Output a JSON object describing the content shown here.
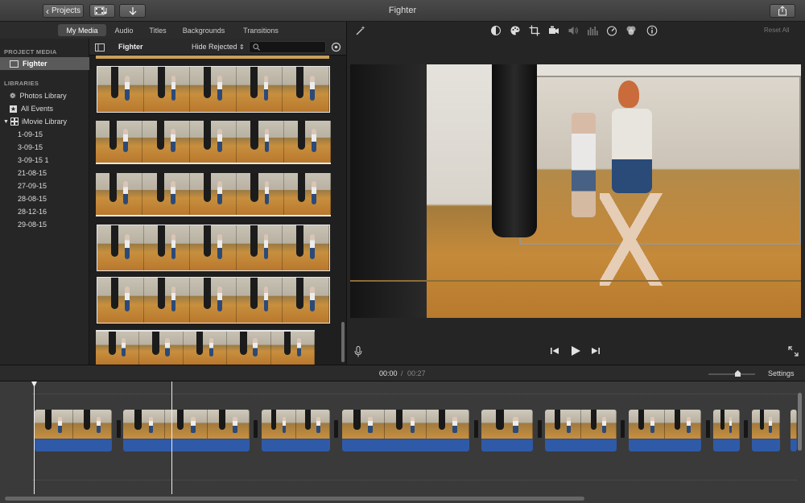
{
  "window": {
    "title": "Fighter"
  },
  "toolbar": {
    "projects_label": "Projects",
    "projects_chevron": "‹",
    "media_icon": "film-music-icon",
    "import_icon": "down-arrow-icon",
    "share_icon": "share-icon"
  },
  "tabs": [
    {
      "label": "My Media",
      "active": true
    },
    {
      "label": "Audio",
      "active": false
    },
    {
      "label": "Titles",
      "active": false
    },
    {
      "label": "Backgrounds",
      "active": false
    },
    {
      "label": "Transitions",
      "active": false
    }
  ],
  "sidebar": {
    "project_media_heading": "PROJECT MEDIA",
    "project_item": "Fighter",
    "libraries_heading": "LIBRARIES",
    "photos_library": "Photos Library",
    "all_events": "All Events",
    "imovie_library": "iMovie Library",
    "events": [
      "1-09-15",
      "3-09-15",
      "3-09-15 1",
      "21-08-15",
      "27-09-15",
      "28-08-15",
      "28-12-16",
      "29-08-15"
    ]
  },
  "browser": {
    "event_name": "Fighter",
    "filter_label": "Hide Rejected",
    "filter_arrows": "⌃",
    "search_placeholder": ""
  },
  "viewer": {
    "reset_all_label": "Reset All",
    "tools": [
      "magic-wand-icon",
      "color-balance-icon",
      "color-palette-icon",
      "crop-icon",
      "camera-stabilization-icon",
      "volume-icon",
      "equalizer-icon",
      "speedometer-icon",
      "clip-filter-icon",
      "info-icon"
    ]
  },
  "timeline": {
    "current_time": "00:00",
    "separator": "/",
    "total_time": "00:27",
    "settings_label": "Settings",
    "zoom_level": 0.6
  },
  "colors": {
    "audio_track": "#2f5aa8",
    "selection": "#e8e8e8",
    "background": "#1e1e1e"
  }
}
